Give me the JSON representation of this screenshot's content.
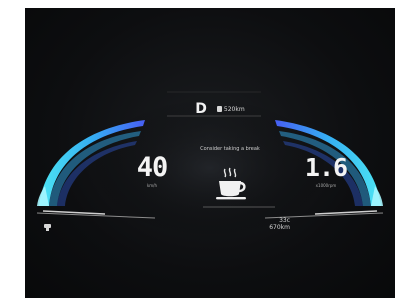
{
  "status": {
    "gear": "D",
    "range_top": "520km"
  },
  "speed": {
    "value": "40",
    "unit": "km/h"
  },
  "right_gauge": {
    "value": "1.6",
    "unit": "x1000rpm"
  },
  "alert": {
    "message": "Consider taking a break",
    "icon": "coffee-cup-icon"
  },
  "bottom": {
    "line1": "33c",
    "line2": "670km"
  },
  "colors": {
    "accent_blue": "#37b7ff",
    "accent_cyan": "#50f0ff",
    "accent_purple": "#4a62ff",
    "text_primary": "#f4f4f4",
    "background": "#0d0e10"
  }
}
